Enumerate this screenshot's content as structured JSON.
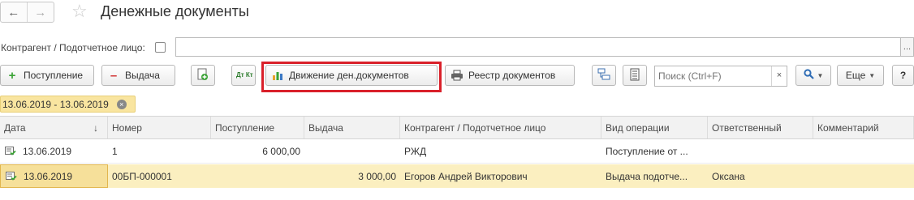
{
  "window": {
    "title": "Денежные документы",
    "back_icon": "←",
    "forward_icon": "→",
    "favorite_icon": "☆"
  },
  "filter": {
    "label": "Контрагент / Подотчетное лицо:",
    "value": "",
    "dots": "..."
  },
  "toolbar": {
    "receipt_label": "Поступление",
    "issue_label": "Выдача",
    "movement_label": "Движение ден.документов",
    "registry_label": "Реестр документов",
    "dtkt_label": "Дт Кт",
    "search_placeholder": "Поиск (Ctrl+F)",
    "search_clear": "×",
    "more_label": "Еще",
    "help_label": "?"
  },
  "period": {
    "label": "13.06.2019 - 13.06.2019",
    "close": "×"
  },
  "table": {
    "columns": [
      "Дата",
      "Номер",
      "Поступление",
      "Выдача",
      "Контрагент / Подотчетное лицо",
      "Вид операции",
      "Ответственный",
      "Комментарий"
    ],
    "sort_indicator": "↓",
    "rows": [
      {
        "date": "13.06.2019",
        "number": "1",
        "receipt": "6 000,00",
        "issue": "",
        "counterparty": "РЖД",
        "operation": "Поступление от ...",
        "responsible": "",
        "comment": ""
      },
      {
        "date": "13.06.2019",
        "number": "00БП-000001",
        "receipt": "",
        "issue": "3 000,00",
        "counterparty": "Егоров Андрей Викторович",
        "operation": "Выдача подотче...",
        "responsible": "Оксана",
        "comment": ""
      }
    ]
  },
  "colors": {
    "highlight_frame": "#d9202a",
    "selected_row": "#fbefc0",
    "period_chip": "#f9e5a0",
    "plus": "#3aa335",
    "minus": "#d23333"
  }
}
